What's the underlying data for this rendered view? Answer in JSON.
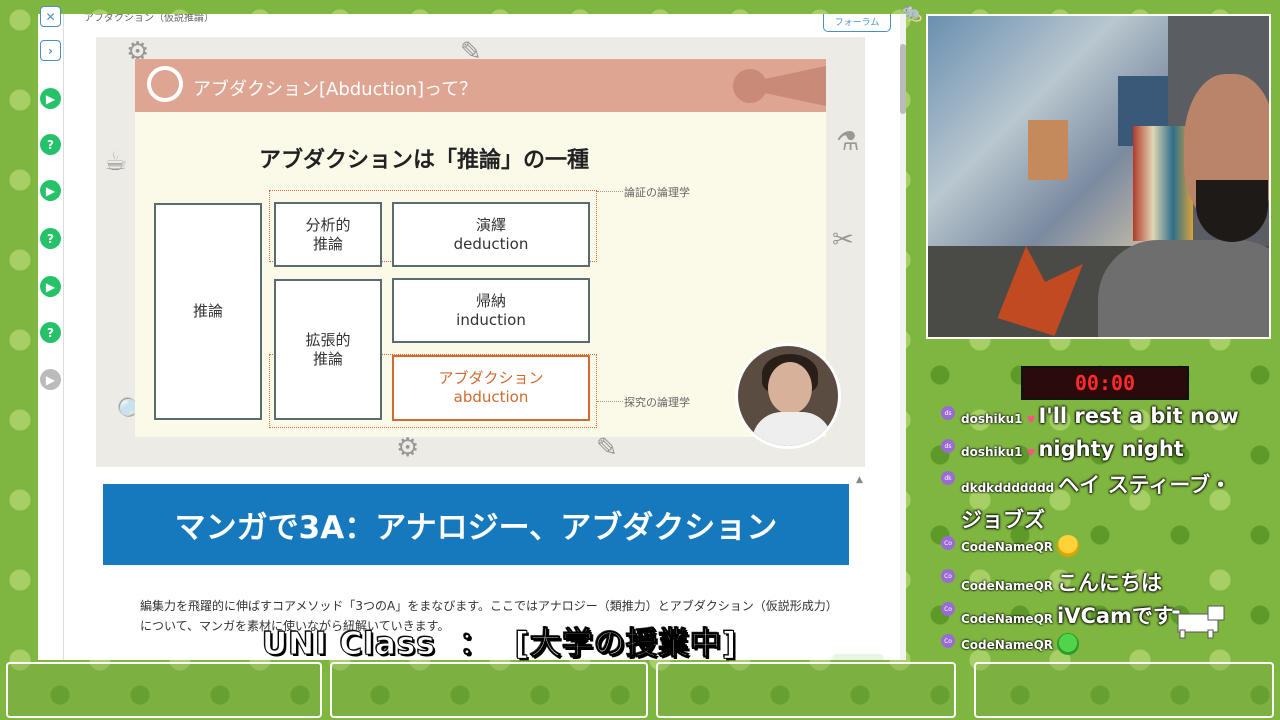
{
  "page": {
    "breadcrumb": "アブダクション（仮説推論）",
    "forum_button": "フォーラム"
  },
  "slide": {
    "title": "アブダクション[Abduction]って？",
    "heading": "アブダクションは「推論」の一種",
    "box_inference": "推論",
    "box_analytic": "分析的\n推論",
    "box_deduction": "演繹\ndeduction",
    "box_expansive": "拡張的\n推論",
    "box_induction": "帰納\ninduction",
    "box_abduction": "アブダクション\nabduction",
    "label_proof": "論証の論理学",
    "label_inquiry": "探究の論理学"
  },
  "banner": "マンガで3A：アナロジー、アブダクション",
  "description": "編集力を飛躍的に伸ばすコアメソッド「3つのA」をまなびます。ここではアナロジー（類推力）とアブダクション（仮説形成力）について、マンガを素材に使いながら紐解いていきます。",
  "subtitle": "UNI Class  ：  [大学の授業中]",
  "timer": "00:00",
  "chat": [
    {
      "user": "doshiku1",
      "text": "I'll rest a bit now",
      "heart": "♥"
    },
    {
      "user": "doshiku1",
      "text": "nighty night",
      "heart": "♥"
    },
    {
      "user": "dkdkddddddd",
      "text": "ヘイ スティーブ・ジョブズ",
      "heart": ""
    },
    {
      "user": "CodeNameQR",
      "text": "",
      "heart": ""
    },
    {
      "user": "CodeNameQR",
      "text": "こんにちは",
      "heart": ""
    },
    {
      "user": "CodeNameQR",
      "text": "iVCamです",
      "heart": ""
    },
    {
      "user": "CodeNameQR",
      "text": "",
      "heart": ""
    }
  ],
  "colors": {
    "banner": "#1679bd",
    "slide_header": "#dea593",
    "abduction_accent": "#d16b30",
    "timer_text": "#ff2a2a",
    "rail_button": "#26c26a"
  },
  "icons": {
    "rail": [
      "close-icon",
      "chevron-right-icon",
      "play-icon",
      "help-icon",
      "play-icon",
      "help-icon",
      "play-icon",
      "help-icon",
      "play-icon"
    ],
    "emotes": [
      "grinning-emote",
      "frog-emote"
    ]
  }
}
